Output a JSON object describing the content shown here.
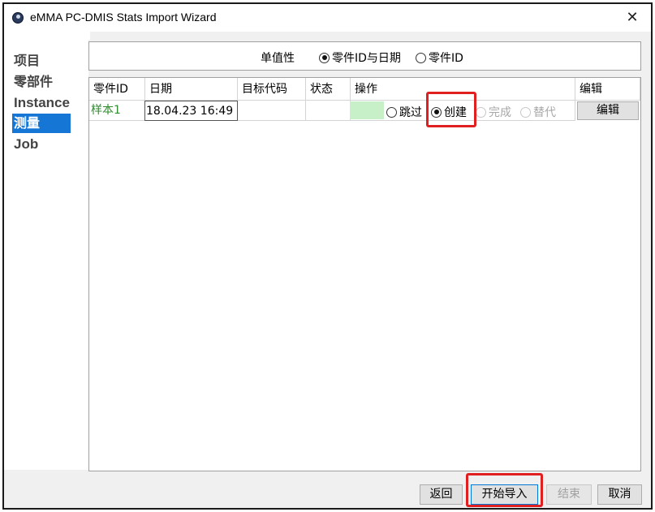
{
  "window": {
    "title": "eMMA PC-DMIS Stats Import Wizard",
    "close_glyph": "✕"
  },
  "sidebar": {
    "items": [
      {
        "label": "项目",
        "active": false
      },
      {
        "label": "零部件",
        "active": false
      },
      {
        "label": "Instance",
        "active": false
      },
      {
        "label": "测量",
        "active": true
      },
      {
        "label": "Job",
        "active": false
      }
    ]
  },
  "uniqueness": {
    "label": "单值性",
    "options": [
      {
        "label": "零件ID与日期",
        "checked": true
      },
      {
        "label": "零件ID",
        "checked": false
      }
    ]
  },
  "table": {
    "columns": [
      "零件ID",
      "日期",
      "目标代码",
      "状态",
      "操作",
      "编辑"
    ],
    "rows": [
      {
        "part_id": "样本1",
        "date": "18.04.23 16:49",
        "target_code": "",
        "status": "",
        "operations": [
          {
            "label": "跳过",
            "checked": false,
            "enabled": true
          },
          {
            "label": "创建",
            "checked": true,
            "enabled": true
          },
          {
            "label": "完成",
            "checked": false,
            "enabled": false
          },
          {
            "label": "替代",
            "checked": false,
            "enabled": false
          }
        ],
        "edit_label": "编辑"
      }
    ]
  },
  "footer": {
    "back": "返回",
    "start_import": "开始导入",
    "finish": "结束",
    "cancel": "取消"
  },
  "colors": {
    "accent": "#1576d6",
    "highlight": "#e02020",
    "part_id_text": "#2e8b2e",
    "status_swatch": "#c8f0c8"
  }
}
